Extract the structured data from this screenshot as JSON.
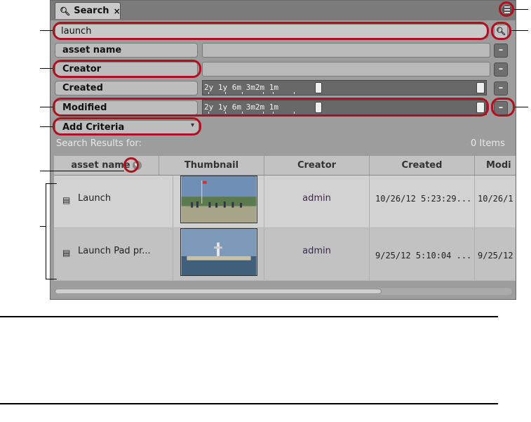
{
  "tab": {
    "label": "Search",
    "close": "×"
  },
  "search": {
    "query": "launch"
  },
  "criteria": [
    {
      "label": "asset name",
      "value": ""
    },
    {
      "label": "Creator",
      "value": ""
    },
    {
      "label": "Created",
      "timeline": "2y 1y 6m 3m2m 1m"
    },
    {
      "label": "Modified",
      "timeline": "2y 1y 6m 3m2m 1m"
    }
  ],
  "minus_label": "–",
  "add_criteria": "Add Criteria",
  "results": {
    "label": "Search Results for:",
    "count": "0 Items",
    "columns": [
      "asset name",
      "Thumbnail",
      "Creator",
      "Created",
      "Modi"
    ],
    "rows": [
      {
        "name": "Launch",
        "creator": "admin",
        "created": "10/26/12 5:23:29...",
        "modified": "10/26/1"
      },
      {
        "name": "Launch Pad pr...",
        "creator": "admin",
        "created": "9/25/12 5:10:04 ...",
        "modified": "9/25/12"
      }
    ]
  },
  "colors": {
    "callout": "#b1101e",
    "panel": "#9d9d9d"
  },
  "icons": [
    "search-icon",
    "close-icon",
    "panel-menu-icon",
    "search-button-icon",
    "sort-descending-icon",
    "video-asset-icon",
    "dropdown-caret-icon"
  ]
}
